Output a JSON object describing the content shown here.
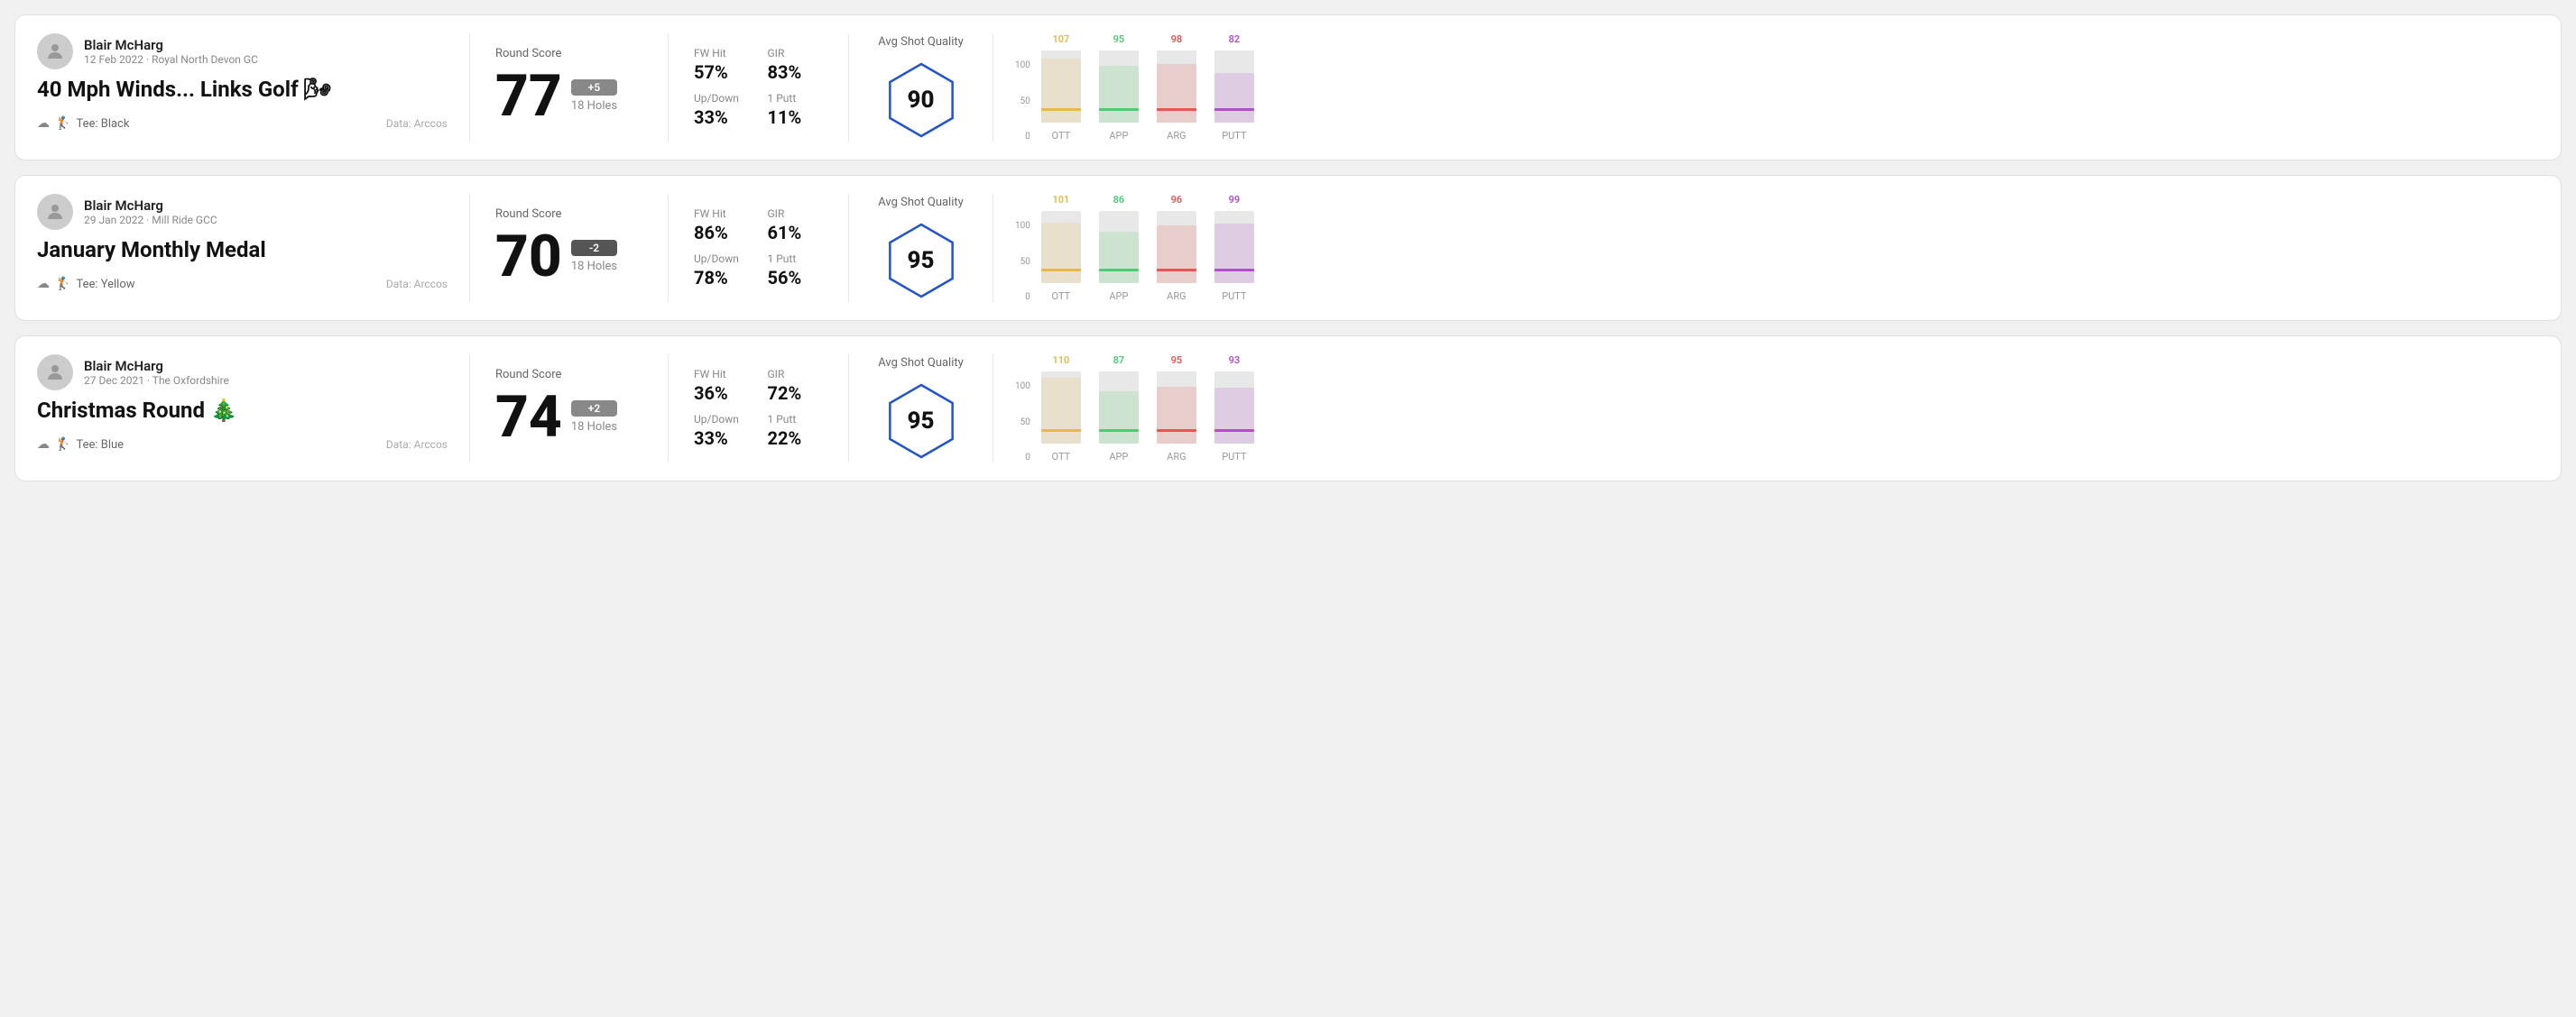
{
  "cards": [
    {
      "id": "card1",
      "user": {
        "name": "Blair McHarg",
        "date": "12 Feb 2022 · Royal North Devon GC"
      },
      "title": "40 Mph Winds... Links Golf 🌬",
      "tee": "Black",
      "data_source": "Data: Arccos",
      "round_score_label": "Round Score",
      "score": "77",
      "badge": "+5",
      "badge_type": "positive",
      "holes": "18 Holes",
      "fw_hit_label": "FW Hit",
      "fw_hit_value": "57%",
      "gir_label": "GIR",
      "gir_value": "83%",
      "updown_label": "Up/Down",
      "updown_value": "33%",
      "oneputt_label": "1 Putt",
      "oneputt_value": "11%",
      "avg_shot_quality_label": "Avg Shot Quality",
      "quality_score": "90",
      "chart": {
        "bars": [
          {
            "label": "OTT",
            "value": 107,
            "color": "#e8b84b"
          },
          {
            "label": "APP",
            "value": 95,
            "color": "#4ecb71"
          },
          {
            "label": "ARG",
            "value": 98,
            "color": "#e85555"
          },
          {
            "label": "PUTT",
            "value": 82,
            "color": "#b04ecb"
          }
        ],
        "max": 110,
        "y_labels": [
          "100",
          "50",
          "0"
        ]
      }
    },
    {
      "id": "card2",
      "user": {
        "name": "Blair McHarg",
        "date": "29 Jan 2022 · Mill Ride GCC"
      },
      "title": "January Monthly Medal",
      "tee": "Yellow",
      "data_source": "Data: Arccos",
      "round_score_label": "Round Score",
      "score": "70",
      "badge": "-2",
      "badge_type": "negative",
      "holes": "18 Holes",
      "fw_hit_label": "FW Hit",
      "fw_hit_value": "86%",
      "gir_label": "GIR",
      "gir_value": "61%",
      "updown_label": "Up/Down",
      "updown_value": "78%",
      "oneputt_label": "1 Putt",
      "oneputt_value": "56%",
      "avg_shot_quality_label": "Avg Shot Quality",
      "quality_score": "95",
      "chart": {
        "bars": [
          {
            "label": "OTT",
            "value": 101,
            "color": "#e8b84b"
          },
          {
            "label": "APP",
            "value": 86,
            "color": "#4ecb71"
          },
          {
            "label": "ARG",
            "value": 96,
            "color": "#e85555"
          },
          {
            "label": "PUTT",
            "value": 99,
            "color": "#b04ecb"
          }
        ],
        "max": 110,
        "y_labels": [
          "100",
          "50",
          "0"
        ]
      }
    },
    {
      "id": "card3",
      "user": {
        "name": "Blair McHarg",
        "date": "27 Dec 2021 · The Oxfordshire"
      },
      "title": "Christmas Round 🎄",
      "tee": "Blue",
      "data_source": "Data: Arccos",
      "round_score_label": "Round Score",
      "score": "74",
      "badge": "+2",
      "badge_type": "positive",
      "holes": "18 Holes",
      "fw_hit_label": "FW Hit",
      "fw_hit_value": "36%",
      "gir_label": "GIR",
      "gir_value": "72%",
      "updown_label": "Up/Down",
      "updown_value": "33%",
      "oneputt_label": "1 Putt",
      "oneputt_value": "22%",
      "avg_shot_quality_label": "Avg Shot Quality",
      "quality_score": "95",
      "chart": {
        "bars": [
          {
            "label": "OTT",
            "value": 110,
            "color": "#e8b84b"
          },
          {
            "label": "APP",
            "value": 87,
            "color": "#4ecb71"
          },
          {
            "label": "ARG",
            "value": 95,
            "color": "#e85555"
          },
          {
            "label": "PUTT",
            "value": 93,
            "color": "#b04ecb"
          }
        ],
        "max": 110,
        "y_labels": [
          "100",
          "50",
          "0"
        ]
      }
    }
  ]
}
